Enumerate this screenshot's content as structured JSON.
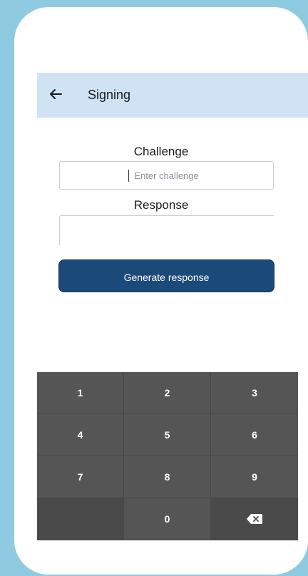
{
  "app_bar": {
    "title": "Signing",
    "back_icon": "arrow-left-icon"
  },
  "form": {
    "challenge_label": "Challenge",
    "challenge_placeholder": "Enter challenge",
    "challenge_value": "",
    "response_label": "Response",
    "response_value": "",
    "generate_button_label": "Generate response"
  },
  "keypad": {
    "keys": [
      "1",
      "2",
      "3",
      "4",
      "5",
      "6",
      "7",
      "8",
      "9",
      "",
      "0",
      ""
    ],
    "backspace_icon": "backspace-icon"
  },
  "colors": {
    "background": "#8ecbe0",
    "app_bar": "#cfe3f5",
    "primary_button": "#1b4a7a",
    "keypad": "#555555"
  }
}
